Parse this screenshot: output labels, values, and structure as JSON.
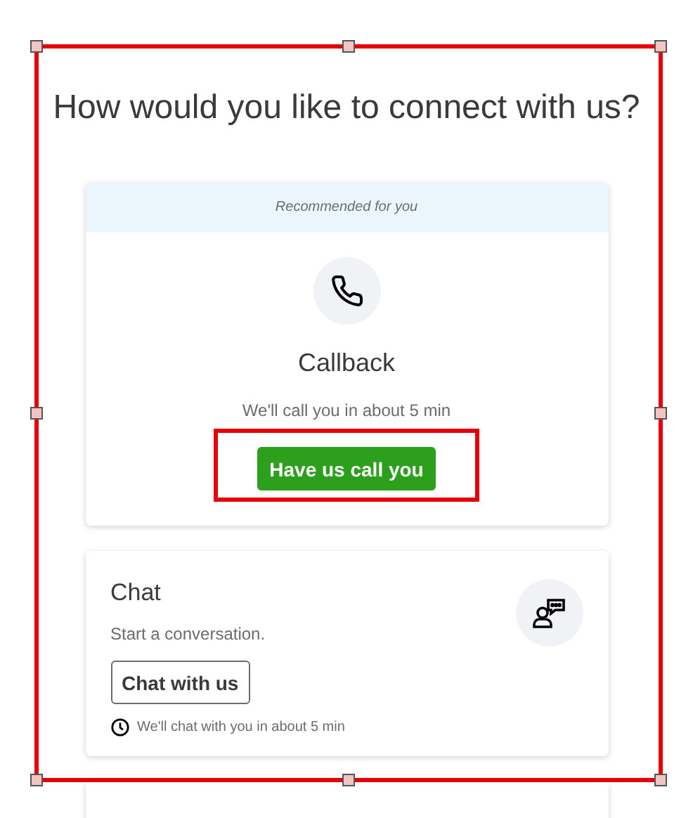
{
  "title": "How would you like to connect with us?",
  "options": [
    {
      "kind": "recommended",
      "banner": "Recommended for you",
      "name": "Callback",
      "description": "We'll call you in about 5 min",
      "action": {
        "label": "Have us call you",
        "highlighted": true
      }
    },
    {
      "kind": "side",
      "name": "Chat",
      "description": "Start a conversation.",
      "action": {
        "label": "Chat with us",
        "highlighted": false
      },
      "note": "We'll chat with you in about 5 min"
    }
  ],
  "selection_frame": {
    "shown": true
  }
}
